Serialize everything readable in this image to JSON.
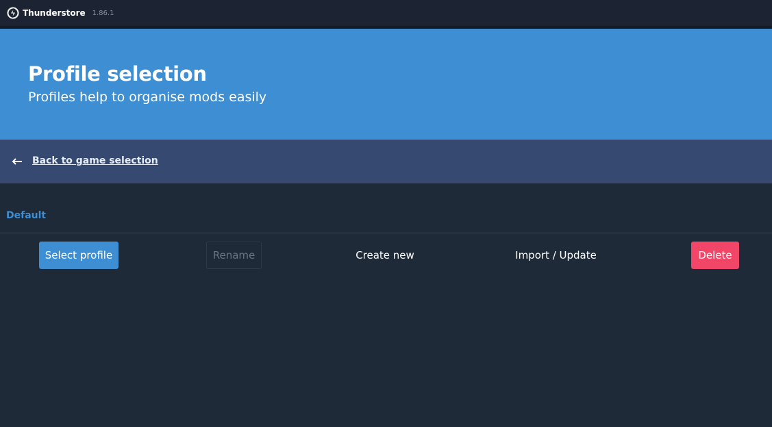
{
  "app": {
    "name": "Thunderstore",
    "version": "1.86.1",
    "logo_icon": "thunderstore-logo-icon"
  },
  "hero": {
    "title": "Profile selection",
    "subtitle": "Profiles help to organise mods easily"
  },
  "navigation": {
    "back_icon": "arrow-left-icon",
    "back_label": "Back to game selection"
  },
  "profiles": [
    {
      "name": "Default"
    }
  ],
  "actions": {
    "select_label": "Select profile",
    "rename_label": "Rename",
    "create_label": "Create new",
    "import_label": "Import / Update",
    "delete_label": "Delete"
  },
  "colors": {
    "accent": "#3e8ed3",
    "background": "#1f2a38",
    "titlebar": "#1c2433",
    "backbar": "#364970",
    "danger": "#f14668"
  }
}
